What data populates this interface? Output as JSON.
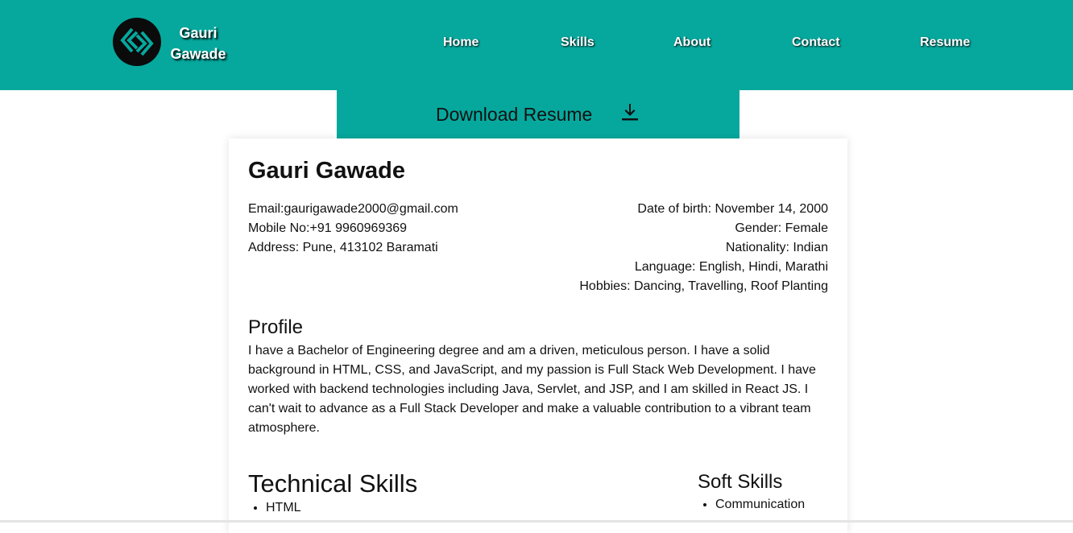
{
  "nav": {
    "brand_first": "Gauri",
    "brand_last": "Gawade",
    "links": [
      "Home",
      "Skills",
      "About",
      "Contact",
      "Resume"
    ],
    "logo_icon": "diamond-link-logo",
    "color": "#06a89d"
  },
  "download": {
    "label": "Download Resume",
    "icon": "download-icon"
  },
  "resume": {
    "name": "Gauri Gawade",
    "contact_left": [
      "Email:gaurigawade2000@gmail.com",
      "Mobile No:+91 9960969369",
      "Address: Pune, 413102 Baramati"
    ],
    "contact_right": [
      "Date of birth: November 14, 2000",
      "Gender: Female",
      "Nationality: Indian",
      "Language: English, Hindi, Marathi",
      "Hobbies: Dancing, Travelling, Roof Planting"
    ],
    "profile_title": "Profile",
    "profile_text": "I have a Bachelor of Engineering degree and am a driven, meticulous person. I have a solid background in HTML, CSS, and JavaScript, and my passion is Full Stack Web Development. I have worked with backend technologies including Java, Servlet, and JSP, and I am skilled in React JS. I can't wait to advance as a Full Stack Developer and make a valuable contribution to a vibrant team atmosphere.",
    "technical_title": "Technical Skills",
    "technical_skills": [
      "HTML"
    ],
    "soft_title": "Soft Skills",
    "soft_skills": [
      "Communication"
    ]
  }
}
